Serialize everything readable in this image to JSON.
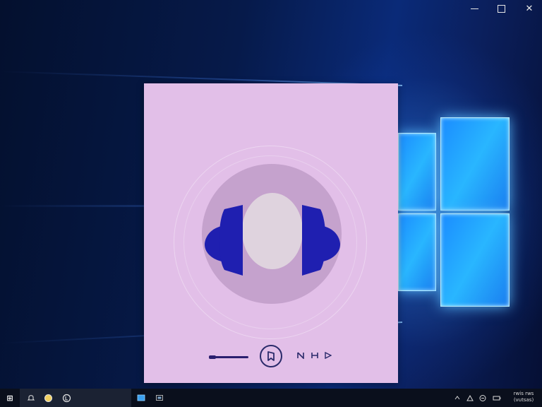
{
  "window": {
    "caption_buttons": [
      {
        "name": "minimize",
        "icon": "minimize-icon"
      },
      {
        "name": "maximize",
        "icon": "maximize-icon"
      },
      {
        "name": "close",
        "icon": "close-icon",
        "glyph": "✕"
      }
    ]
  },
  "player": {
    "background_color": "#e2bfe8",
    "artwork_icon": "headphones-icon",
    "accent_color": "#1f1fb0",
    "progress": 0.15,
    "controls": [
      {
        "name": "play-pause",
        "icon": "pause-icon"
      },
      {
        "name": "previous",
        "icon": "skip-back-icon"
      },
      {
        "name": "next",
        "icon": "skip-forward-icon"
      },
      {
        "name": "play",
        "icon": "play-icon"
      }
    ]
  },
  "taskbar": {
    "start_glyph": "⊞",
    "pinned_icons": [
      "bell-icon",
      "browser-icon",
      "media-icon",
      "file-explorer-icon",
      "window-icon"
    ],
    "tray_icons": [
      "chevron-up-icon",
      "network-icon",
      "volume-icon",
      "battery-icon"
    ],
    "clock": {
      "line1": "rwis rws",
      "line2": "(vutsas)"
    }
  },
  "desktop": {
    "wallpaper": "windows-10-hero",
    "accent_color": "#1a8cff"
  }
}
